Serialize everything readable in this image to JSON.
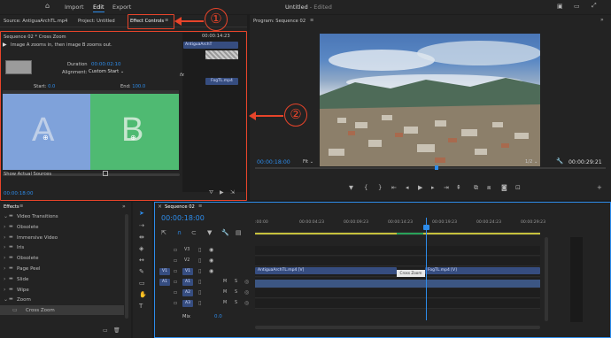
{
  "topbar": {
    "home_icon": "home-icon",
    "import": "Import",
    "edit": "Edit",
    "export": "Export",
    "title": "Untitled",
    "edited": "- Edited"
  },
  "source_panel": {
    "source_tab": "Source: AntiguaArchTL.mp4",
    "project_tab": "Project: Untitled",
    "effect_controls_tab": "Effect Controls",
    "menu": "≡"
  },
  "effect_controls": {
    "header": "Sequence 02 * Cross Zoom",
    "description": "Image A zooms in, then image B zooms out.",
    "duration_label": "Duration",
    "duration_value": "00:00:02:10",
    "alignment_label": "Alignment:",
    "alignment_value": "Custom Start",
    "start_label": "Start:",
    "start_value": "0.0",
    "end_label": "End:",
    "end_value": "100.0",
    "letter_a": "A",
    "letter_b": "B",
    "show_actual_sources": "Show Actual Sources",
    "mini_time": "00:00:14:23",
    "clip_a": "AntiguaArchT",
    "clip_b": "FogTL.mp4",
    "fx": "fx",
    "timecode": "00:00:18:00"
  },
  "program": {
    "title": "Program: Sequence 02",
    "menu": "≡",
    "timecode": "00:00:18:00",
    "fit": "Fit",
    "resolution": "1/2",
    "duration": "00:00:29:21"
  },
  "effects_panel": {
    "title": "Effects",
    "menu": "≡",
    "items": [
      {
        "label": "Video Transitions",
        "type": "folder-open"
      },
      {
        "label": "Obsolete",
        "type": "folder"
      },
      {
        "label": "Immersive Video",
        "type": "folder"
      },
      {
        "label": "Iris",
        "type": "folder"
      },
      {
        "label": "Obsolete",
        "type": "folder"
      },
      {
        "label": "Page Peel",
        "type": "folder"
      },
      {
        "label": "Slide",
        "type": "folder"
      },
      {
        "label": "Wipe",
        "type": "folder"
      },
      {
        "label": "Zoom",
        "type": "folder-open"
      },
      {
        "label": "Cross Zoom",
        "type": "effect"
      }
    ]
  },
  "timeline": {
    "tab": "Sequence 02",
    "menu": "≡",
    "timecode": "00:00:18:00",
    "ruler": [
      ":00:00",
      "00:00:04:23",
      "00:00:09:23",
      "00:00:14:23",
      "00:00:19:23",
      "00:00:24:23",
      "00:00:29:23"
    ],
    "tracks": [
      {
        "name": "V3",
        "type": "video"
      },
      {
        "name": "V2",
        "type": "video"
      },
      {
        "name": "V1",
        "type": "video"
      },
      {
        "name": "A1",
        "type": "audio"
      },
      {
        "name": "A2",
        "type": "audio"
      },
      {
        "name": "A3",
        "type": "audio"
      }
    ],
    "src_v": "V1",
    "src_a": "A1",
    "mix_label": "Mix",
    "mix_value": "0.0",
    "clip_a": "AntiguaArchTL.mp4 [V]",
    "transition_label": "Cross Zoom",
    "clip_b": "FogTL.mp4 [V]",
    "m_label": "M",
    "s_label": "S"
  },
  "annotations": {
    "one": "①",
    "two": "②"
  },
  "colors": {
    "accent": "#2d8ceb",
    "annotation": "#e8442a",
    "panel_a": "#7fa2da",
    "panel_b": "#4fba72"
  }
}
